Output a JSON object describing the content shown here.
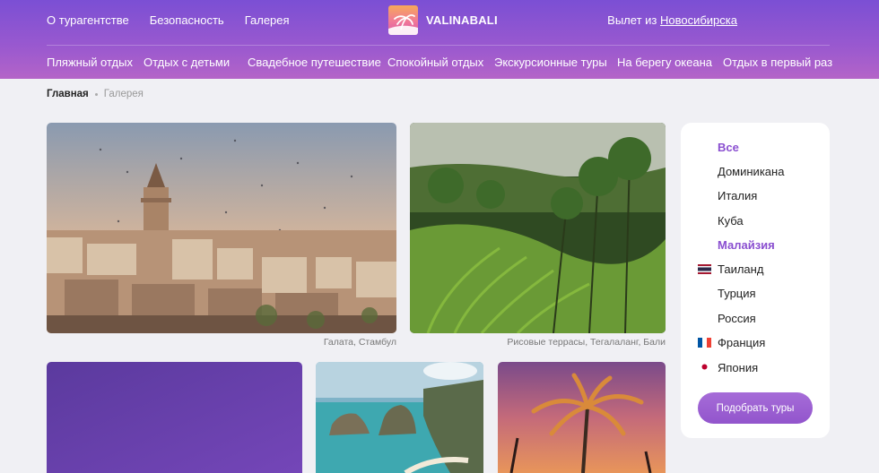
{
  "header": {
    "top_nav": [
      "О турагентстве",
      "Безопасность",
      "Галерея"
    ],
    "brand": "VALINABALI",
    "departure_label": "Вылет из",
    "departure_city": "Новосибирска",
    "categories": [
      "Пляжный отдых",
      "Отдых с детьми",
      "Свадебное путешествие",
      "Спокойный отдых",
      "Экскурсионные туры",
      "На берегу океана",
      "Отдых в первый раз"
    ]
  },
  "breadcrumb": {
    "home": "Главная",
    "current": "Галерея"
  },
  "gallery": {
    "captions": [
      "Галата, Стамбул",
      "Рисовые террасы, Тегалаланг, Бали"
    ]
  },
  "sidebar": {
    "countries": [
      {
        "label": "Все",
        "active": true,
        "flag": ""
      },
      {
        "label": "Доминикана",
        "active": false,
        "flag": ""
      },
      {
        "label": "Италия",
        "active": false,
        "flag": ""
      },
      {
        "label": "Куба",
        "active": false,
        "flag": ""
      },
      {
        "label": "Малайзия",
        "active": true,
        "flag": ""
      },
      {
        "label": "Таиланд",
        "active": false,
        "flag": "thailand-flag-icon"
      },
      {
        "label": "Турция",
        "active": false,
        "flag": ""
      },
      {
        "label": "Россия",
        "active": false,
        "flag": ""
      },
      {
        "label": "Франция",
        "active": false,
        "flag": "france-flag-icon"
      },
      {
        "label": "Япония",
        "active": false,
        "flag": "japan-flag-icon"
      }
    ],
    "cta": "Подобрать туры"
  },
  "colors": {
    "accent": "#8a4fd0",
    "header_start": "#7b4fd4",
    "header_end": "#b464c8"
  }
}
